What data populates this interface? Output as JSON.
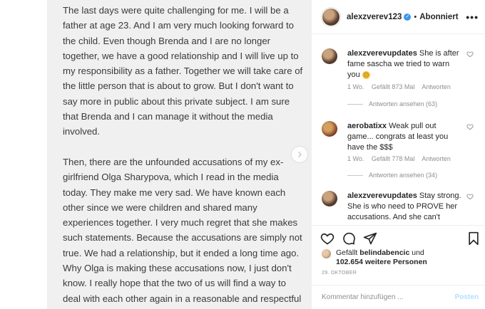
{
  "post": {
    "paragraph_1": "The last days were quite challenging for me. I will be a father at age 23. And I am very much looking forward to the child. Even though Brenda and I are no longer together, we have a good relationship and I will live up to my responsibility as a father. Together we will take care of the little person that is about to grow. But I don't want to say more in public about this private subject. I am sure that Brenda and I can manage it without the media involved.",
    "paragraph_2": "Then, there are the unfounded accusations of my ex-girlfriend Olga Sharypova, which I read in the media today. They make me very sad. We have known each other since we were children and shared many experiences together. I very much regret that she makes such statements. Because the accusations are simply not true. We had a relationship, but it ended a long time ago. Why Olga is making these accusations now, I just don't know. I really hope that the two of us will find a way to deal with each other again in a reasonable and respectful way."
  },
  "header": {
    "username": "alexzverev123",
    "separator": "•",
    "follow_state": "Abonniert",
    "more": "•••"
  },
  "comments": [
    {
      "user": "alexzverevupdates",
      "text": "She is after fame sascha we tried to warn you",
      "emoji": "☹",
      "time": "1 Wo.",
      "likes": "Gefällt 873 Mal",
      "reply": "Antworten",
      "replies": "Antworten ansehen (63)"
    },
    {
      "user": "aerobatixx",
      "text": "Weak pull out game... congrats at least you have the $$$",
      "time": "1 Wo.",
      "likes": "Gefällt 778 Mal",
      "reply": "Antworten",
      "replies": "Antworten ansehen (34)"
    },
    {
      "user": "alexzverevupdates",
      "text": "Stay strong. She is who need to PROVE her accusations. And she can't"
    }
  ],
  "likes": {
    "prefix": "Gefällt",
    "user": "belindabencic",
    "conj": "und",
    "others": "102.654 weitere Personen"
  },
  "date": "29. OKTOBER",
  "add_comment": {
    "placeholder": "Kommentar hinzufügen ...",
    "post_label": "Posten"
  },
  "icons": {
    "next": "chevron-right-icon",
    "like": "heart-icon",
    "comment": "comment-bubble-icon",
    "share": "paper-plane-icon",
    "save": "bookmark-icon",
    "verified": "verified-badge-icon"
  },
  "colors": {
    "verified": "#3897f0",
    "post_button_disabled": "#b2dffc",
    "muted_text": "#8e8e8e"
  }
}
